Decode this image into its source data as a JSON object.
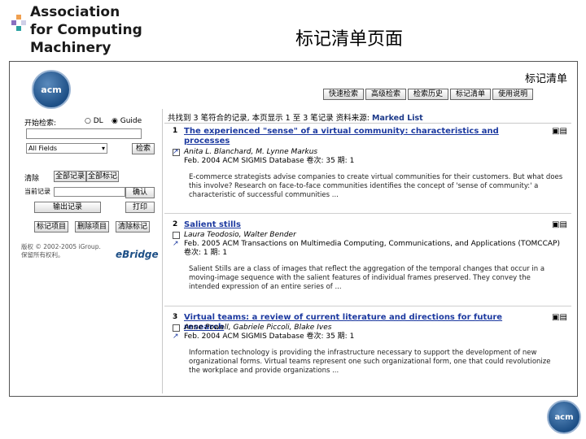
{
  "slide": {
    "left_title_lines": [
      "Association",
      "for Computing",
      "Machinery"
    ],
    "main_title": "标记清单页面",
    "logo_text": "acm"
  },
  "screen": {
    "topbar_title": "标记清单",
    "tabs": [
      "快速检索",
      "高级检索",
      "检索历史",
      "标记清单",
      "使用说明"
    ],
    "sidebar": {
      "start_search_label": "开始检索:",
      "radio_dl_label": "DL",
      "radio_guide_label": "Guide",
      "field_select_value": "All Fields",
      "search_button": "检索",
      "clear_label": "清除",
      "tab_all_records": "全部记录",
      "tab_all_tagged": "全部标记",
      "saved_results_label": "当前记录",
      "confirm_label": "确认",
      "export_button": "输出记录",
      "print_button": "打印",
      "mark_button": "标记项目",
      "remove_button": "删除项目",
      "clear_all_button": "清除标记",
      "copyright": "版权 © 2002-2005 iGroup. 保留所有权利。",
      "brand": "eBridge"
    },
    "summary_prefix": "共找到 3 笔符合的记录, 本页显示 1 至 3 笔记录 资料来源:",
    "summary_source": "Marked List",
    "records": [
      {
        "num": "1",
        "title": "The experienced \"sense\" of a virtual community: characteristics and processes",
        "authors": "Anita L. Blanchard,  M. Lynne Markus",
        "meta": "Feb. 2004   ACM SIGMIS Database  卷次: 35 期: 1",
        "abstract": "E-commerce strategists advise companies to create virtual communities for their customers. But what does this involve? Research on face-to-face communities identifies the concept of 'sense of community:' a characteristic of successful communities ..."
      },
      {
        "num": "2",
        "title": "Salient stills",
        "authors": "Laura Teodosio,  Walter Bender",
        "meta": "Feb. 2005   ACM Transactions on Multimedia Computing, Communications, and Applications (TOMCCAP)  卷次: 1 期: 1",
        "abstract": "Salient Stills are a class of images that reflect the aggregation of the temporal changes that occur in a moving-image sequence with the salient features of individual frames preserved. They convey the intended expression of an entire series of ..."
      },
      {
        "num": "3",
        "title": "Virtual teams: a review of current literature and directions for future research",
        "authors": "Anne Powell,  Gabriele Piccoli,  Blake Ives",
        "meta": "Feb. 2004   ACM SIGMIS Database  卷次: 35 期: 1",
        "abstract": "Information technology is providing the infrastructure necessary to support the development of new organizational forms. Virtual teams represent one such organizational form, one that could revolutionize the workplace and provide organizations ..."
      }
    ]
  },
  "colors": {
    "link": "#1d3aa0",
    "deco_orange": "#f0a050",
    "deco_purple": "#8a6fc0",
    "deco_teal": "#2aa0a0"
  }
}
